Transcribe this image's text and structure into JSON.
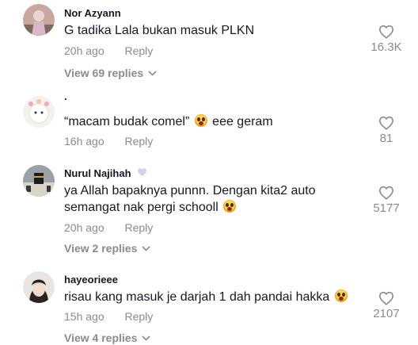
{
  "comments": [
    {
      "username": "Nor Azyann",
      "text": "G tadika Lala bukan masuk PLKN",
      "time": "20h ago",
      "reply_label": "Reply",
      "likes": "16.3K",
      "view_replies": "View 69 replies"
    },
    {
      "username": ".",
      "text": "“macam budak comel” ",
      "text_after": " eee geram",
      "time": "16h ago",
      "reply_label": "Reply",
      "likes": "81",
      "view_replies": ""
    },
    {
      "username": "Nurul Najihah",
      "text_line1": "ya Allah bapaknya punnn. Dengan kita2 auto",
      "text_line2": "semangat nak pergi schooll ",
      "time": "20h ago",
      "reply_label": "Reply",
      "likes": "5177",
      "view_replies": "View 2 replies"
    },
    {
      "username": "hayeorieee",
      "text": "risau kang masuk je darjah 1 dah pandai hakka ",
      "time": "15h ago",
      "reply_label": "Reply",
      "likes": "2107",
      "view_replies": "View 4 replies"
    }
  ],
  "icons": {
    "like": "heart-outline-icon",
    "expand": "chevron-down-icon",
    "emoji": "screaming-face-emoji",
    "badge": "purple-heart-icon"
  },
  "colors": {
    "text": "#161823",
    "secondary": "#8a8b91"
  }
}
